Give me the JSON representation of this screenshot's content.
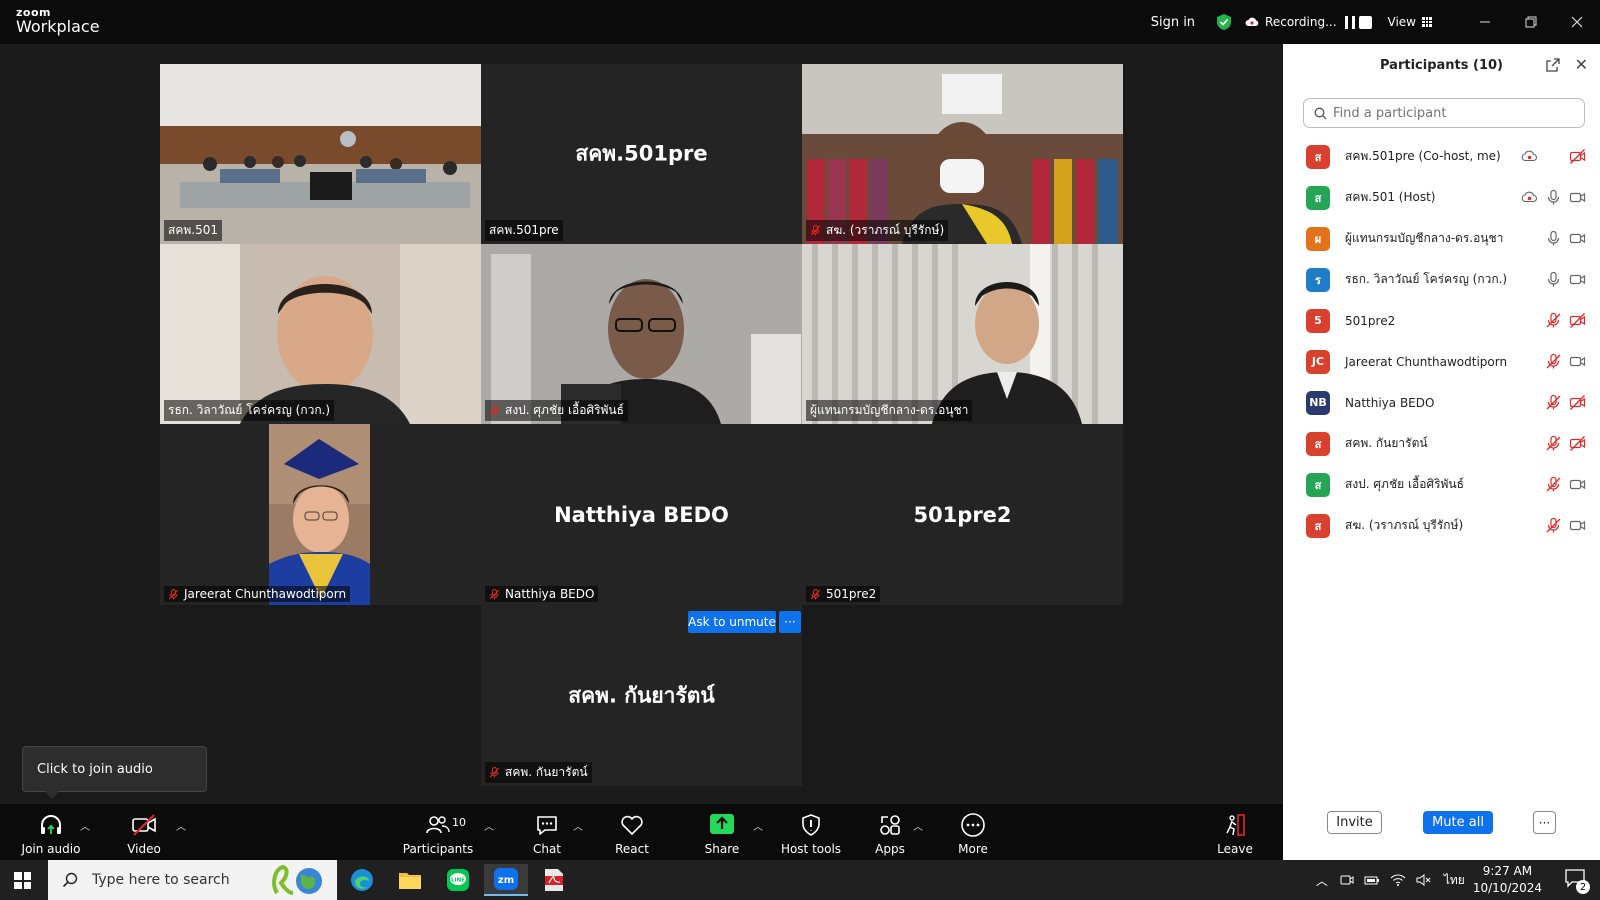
{
  "app": {
    "logo_top": "zoom",
    "logo_bottom": "Workplace"
  },
  "topbar": {
    "sign_in": "Sign in",
    "recording": "Recording...",
    "view": "View",
    "window_controls": [
      "minimize-icon",
      "restore-icon",
      "close-icon"
    ]
  },
  "tiles": [
    {
      "name": "สคพ.501",
      "type": "video",
      "muted": false
    },
    {
      "name": "สคพ.501pre",
      "display": "สคพ.501pre",
      "type": "name",
      "muted": false
    },
    {
      "name": "สฆ. (วราภรณ์ บุรีรักษ์)",
      "type": "video",
      "muted": true
    },
    {
      "name": "รธก. วิลาวัณย์ โคร่ครญ (กวก.)",
      "type": "video",
      "muted": false,
      "active": true
    },
    {
      "name": "สงป. ศุภชัย เอื้อศิริพันธ์",
      "type": "video",
      "muted": true
    },
    {
      "name": "ผู้แทนกรมบัญชีกลาง-ดร.อนุชา",
      "type": "video",
      "muted": false
    },
    {
      "name": "Jareerat Chunthawodtiporn",
      "type": "video",
      "muted": true
    },
    {
      "name": "Natthiya BEDO",
      "display": "Natthiya BEDO",
      "type": "name",
      "muted": true
    },
    {
      "name": "501pre2",
      "display": "501pre2",
      "type": "name",
      "muted": true
    },
    {
      "name": "สคพ. กันยารัตน์",
      "display": "สคพ. กันยารัตน์",
      "type": "name",
      "muted": true
    }
  ],
  "ask_unmute": "Ask to unmute",
  "ask_more": "···",
  "tooltip": "Click to join audio",
  "toolbar": {
    "join_audio": "Join audio",
    "video": "Video",
    "participants": "Participants",
    "participants_count": "10",
    "chat": "Chat",
    "react": "React",
    "share": "Share",
    "host_tools": "Host tools",
    "apps": "Apps",
    "more": "More",
    "leave": "Leave"
  },
  "panel": {
    "title": "Participants (10)",
    "search_placeholder": "Find a participant",
    "participants": [
      {
        "initial": "ส",
        "color": "#d9412e",
        "name": "สคพ.501pre (Co-host, me)",
        "rec": true,
        "mic": "none",
        "cam": "off-red"
      },
      {
        "initial": "ส",
        "color": "#27a556",
        "name": "สคพ.501 (Host)",
        "rec": true,
        "mic": "on",
        "cam": "on"
      },
      {
        "initial": "ผ",
        "color": "#e4711b",
        "name": "ผู้แทนกรมบัญชีกลาง-ดร.อนุชา",
        "rec": false,
        "mic": "on",
        "cam": "on"
      },
      {
        "initial": "ร",
        "color": "#1f7cc7",
        "name": "รธก. วิลาวัณย์ โคร่ครญ (กวก.)",
        "rec": false,
        "mic": "on",
        "cam": "on"
      },
      {
        "initial": "5",
        "color": "#d9412e",
        "name": "501pre2",
        "rec": false,
        "mic": "off",
        "cam": "off-red"
      },
      {
        "initial": "JC",
        "color": "#d9412e",
        "name": "Jareerat Chunthawodtiporn",
        "rec": false,
        "mic": "off",
        "cam": "on"
      },
      {
        "initial": "NB",
        "color": "#283a6e",
        "name": "Natthiya BEDO",
        "rec": false,
        "mic": "off",
        "cam": "off-red"
      },
      {
        "initial": "ส",
        "color": "#d9412e",
        "name": "สคพ. กันยารัตน์",
        "rec": false,
        "mic": "off",
        "cam": "off-red"
      },
      {
        "initial": "ส",
        "color": "#27a556",
        "name": "สงป. ศุภชัย เอื้อศิริพันธ์",
        "rec": false,
        "mic": "off",
        "cam": "on"
      },
      {
        "initial": "ส",
        "color": "#d9412e",
        "name": "สฆ. (วราภรณ์ บุรีรักษ์)",
        "rec": false,
        "mic": "off",
        "cam": "on"
      }
    ],
    "invite": "Invite",
    "mute_all": "Mute all",
    "more": "···"
  },
  "taskbar": {
    "search_placeholder": "Type here to search",
    "lang": "ไทย",
    "time": "9:27 AM",
    "date": "10/10/2024",
    "notifications": "2"
  },
  "colors": {
    "zoom_blue": "#0e72ed",
    "active_speaker": "#23d989",
    "muted_red": "#e02828",
    "share_green": "#23d959"
  }
}
